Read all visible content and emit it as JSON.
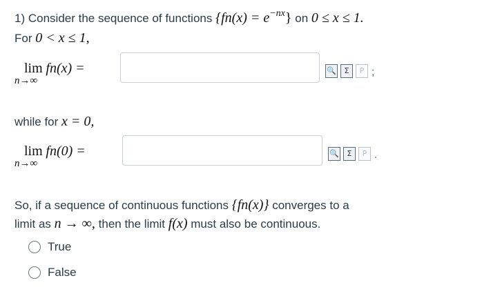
{
  "question": {
    "number": "1)",
    "intro": "Consider the sequence of functions",
    "seq": "{fn(x) = e",
    "exp": "−nx",
    "seq_close": "}",
    "on": "on",
    "interval": "0 ≤ x ≤ 1.",
    "for_text": "For",
    "for_range": "0 < x ≤ 1,",
    "while_text": "while for",
    "while_cond": "x = 0,",
    "statement_l1a": "So, if a sequence of continuous functions",
    "statement_l1b": "{fn(x)}",
    "statement_l1c": "converges to a",
    "statement_l2a": "limit as",
    "statement_l2b": "n → ∞,",
    "statement_l2c": "then the limit",
    "statement_l2d": "f(x)",
    "statement_l2e": "must also be continuous."
  },
  "limit1": {
    "lim": "lim",
    "sub": "n→∞",
    "expr": "fn(x) =",
    "value": "",
    "after": ";"
  },
  "limit2": {
    "lim": "lim",
    "sub": "n→∞",
    "expr": "fn(0) =",
    "value": "",
    "after": "."
  },
  "tools": {
    "preview": "🔍",
    "sum": "Σ",
    "paste": "P"
  },
  "options": [
    {
      "label": "True"
    },
    {
      "label": "False"
    }
  ]
}
